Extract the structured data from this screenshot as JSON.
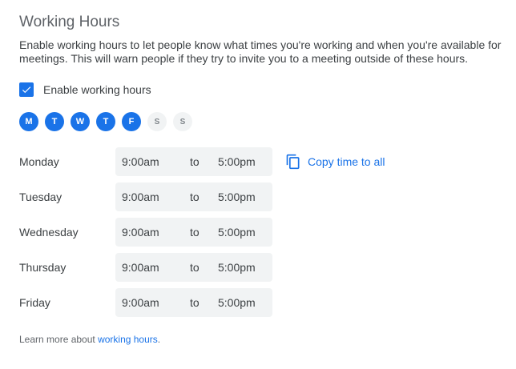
{
  "section": {
    "title": "Working Hours",
    "description": "Enable working hours to let people know what times you're working and when you're available for meetings. This will warn people if they try to invite you to a meeting outside of these hours."
  },
  "enable": {
    "label": "Enable working hours",
    "checked": true
  },
  "days": [
    {
      "letter": "M",
      "selected": true
    },
    {
      "letter": "T",
      "selected": true
    },
    {
      "letter": "W",
      "selected": true
    },
    {
      "letter": "T",
      "selected": true
    },
    {
      "letter": "F",
      "selected": true
    },
    {
      "letter": "S",
      "selected": false
    },
    {
      "letter": "S",
      "selected": false
    }
  ],
  "schedule": [
    {
      "day": "Monday",
      "start": "9:00am",
      "separator": "to",
      "end": "5:00pm"
    },
    {
      "day": "Tuesday",
      "start": "9:00am",
      "separator": "to",
      "end": "5:00pm"
    },
    {
      "day": "Wednesday",
      "start": "9:00am",
      "separator": "to",
      "end": "5:00pm"
    },
    {
      "day": "Thursday",
      "start": "9:00am",
      "separator": "to",
      "end": "5:00pm"
    },
    {
      "day": "Friday",
      "start": "9:00am",
      "separator": "to",
      "end": "5:00pm"
    }
  ],
  "copy_button": {
    "label": "Copy time to all",
    "icon": "copy-icon"
  },
  "footer": {
    "prefix": "Learn more about ",
    "link_text": "working hours",
    "suffix": "."
  },
  "colors": {
    "accent": "#1a73e8",
    "field_bg": "#f1f3f4",
    "muted": "#5f6368"
  }
}
